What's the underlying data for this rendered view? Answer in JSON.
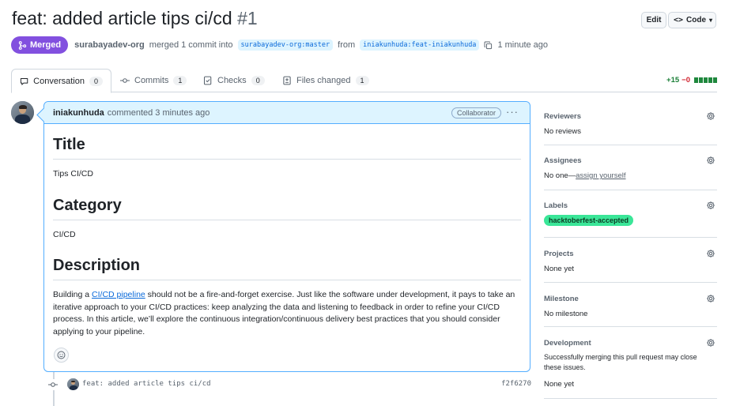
{
  "header": {
    "title": "feat: added article tips ci/cd",
    "number": "#1",
    "edit_label": "Edit",
    "code_label": "Code"
  },
  "status": {
    "badge": "Merged",
    "actor": "surabayadev-org",
    "action": "merged 1 commit into",
    "base_branch": "surabayadev-org:master",
    "from_text": "from",
    "head_branch": "iniakunhuda:feat-iniakunhuda",
    "time": "1 minute ago"
  },
  "tabs": [
    {
      "label": "Conversation",
      "count": "0"
    },
    {
      "label": "Commits",
      "count": "1"
    },
    {
      "label": "Checks",
      "count": "0"
    },
    {
      "label": "Files changed",
      "count": "1"
    }
  ],
  "diffstat": {
    "additions": "+15",
    "deletions": "−0",
    "color": "#1f883d"
  },
  "comment": {
    "author": "iniakunhuda",
    "meta": "commented 3 minutes ago",
    "role_badge": "Collaborator",
    "menu": "···",
    "h_title": "Title",
    "title_value": "Tips CI/CD",
    "h_category": "Category",
    "category_value": "CI/CD",
    "h_description": "Description",
    "desc_pre": "Building a ",
    "desc_link": "CI/CD pipeline",
    "desc_post": " should not be a fire-and-forget exercise. Just like the software under development, it pays to take an iterative approach to your CI/CD practices: keep analyzing the data and listening to feedback in order to refine your CI/CD process. In this article, we’ll explore the continuous integration/continuous delivery best practices that you should consider applying to your pipeline."
  },
  "commit": {
    "message": "feat: added article tips ci/cd",
    "sha": "f2f6270"
  },
  "sidebar": {
    "reviewers": {
      "heading": "Reviewers",
      "value": "No reviews"
    },
    "assignees": {
      "heading": "Assignees",
      "value_pre": "No one—",
      "value_link": "assign yourself"
    },
    "labels": {
      "heading": "Labels",
      "chip": "hacktoberfest-accepted",
      "chip_color": "#3ae698"
    },
    "projects": {
      "heading": "Projects",
      "value": "None yet"
    },
    "milestone": {
      "heading": "Milestone",
      "value": "No milestone"
    },
    "development": {
      "heading": "Development",
      "note": "Successfully merging this pull request may close these issues.",
      "value": "None yet"
    }
  },
  "colors": {
    "merged": "#8250df",
    "link": "#0969da",
    "comment_header_bg": "#ddf4ff",
    "comment_border": "#54aeff"
  }
}
